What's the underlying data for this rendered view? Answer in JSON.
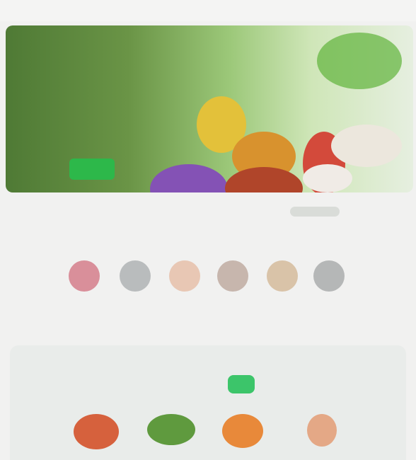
{
  "hero": {
    "title": "",
    "cta_label": ""
  },
  "categories": {
    "heading": "",
    "items": [
      {
        "label": "",
        "color": "#d98f9a"
      },
      {
        "label": "",
        "color": "#b9bcbd"
      },
      {
        "label": "",
        "color": "#e8c7b4"
      },
      {
        "label": "",
        "color": "#c7b6ad"
      },
      {
        "label": "",
        "color": "#d9c3a8"
      },
      {
        "label": "",
        "color": "#b5b7b7"
      }
    ]
  },
  "featured": {
    "heading": "",
    "button_label": "",
    "products": [
      {
        "name": "",
        "color": "#d6613d"
      },
      {
        "name": "",
        "color": "#5f9a3e"
      },
      {
        "name": "",
        "color": "#e8893a"
      },
      {
        "name": "",
        "color": "#e4a886"
      }
    ]
  },
  "colors": {
    "accent_green": "#2db84a",
    "background": "#f1f1f0"
  }
}
